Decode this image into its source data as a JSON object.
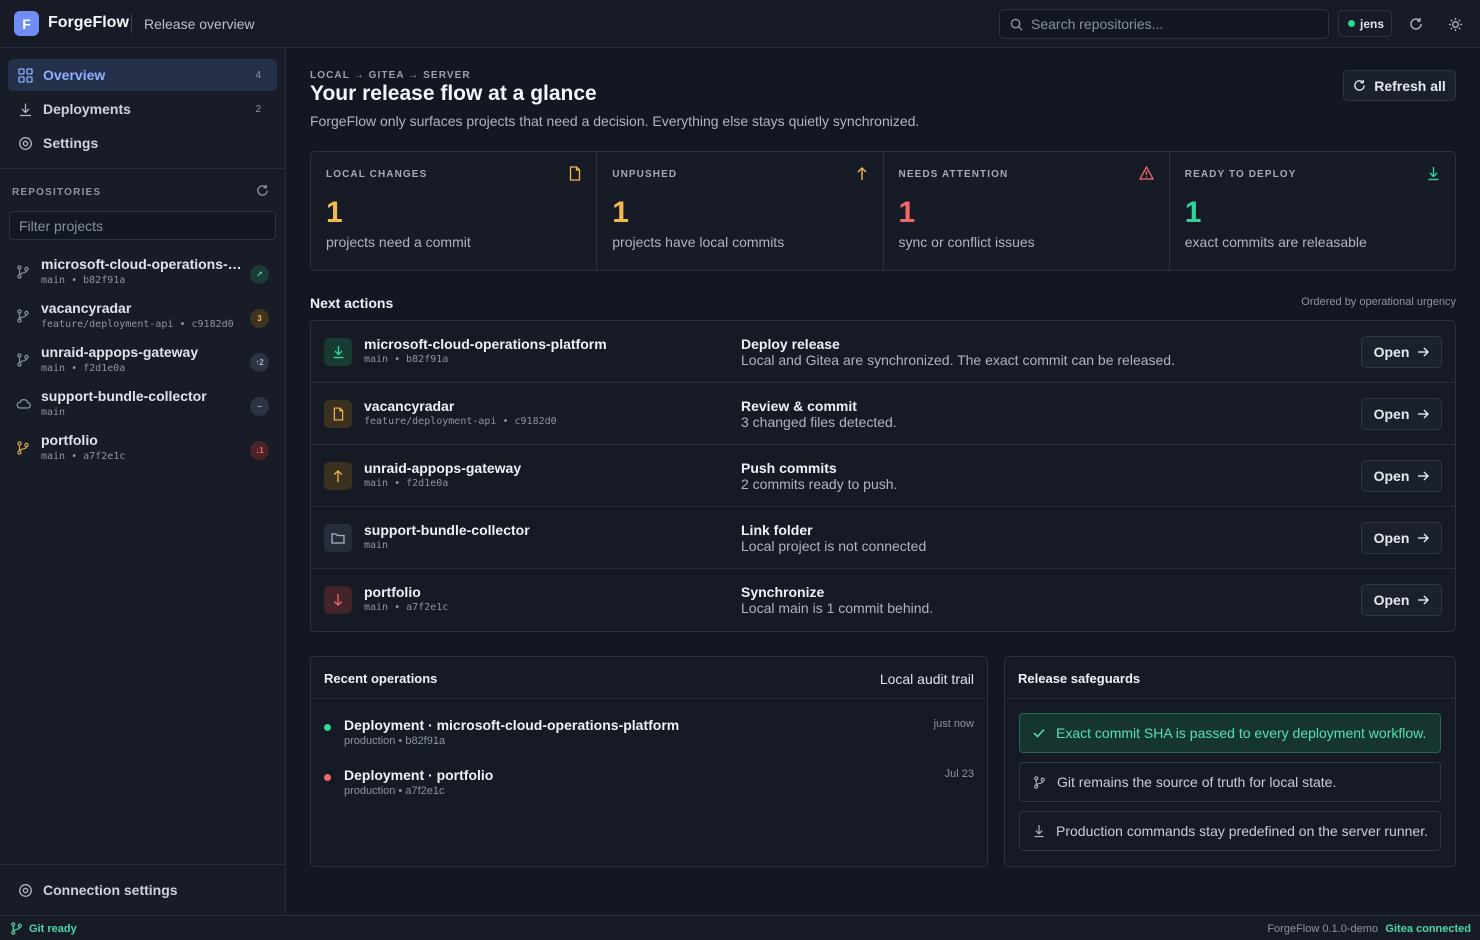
{
  "header": {
    "logo_letter": "F",
    "app_name": "ForgeFlow",
    "page": "Release overview",
    "search_placeholder": "Search repositories...",
    "user": "jens"
  },
  "sidebar": {
    "nav": [
      {
        "label": "Overview",
        "count": "4",
        "icon": "grid-icon",
        "active": true
      },
      {
        "label": "Deployments",
        "count": "2",
        "icon": "download-icon",
        "active": false
      },
      {
        "label": "Settings",
        "count": "",
        "icon": "gear-icon",
        "active": false
      }
    ],
    "section_title": "REPOSITORIES",
    "filter_placeholder": "Filter projects",
    "repos": [
      {
        "name": "microsoft-cloud-operations-platform",
        "branch": "main",
        "sha": "b82f91a",
        "meta": "main • b82f91a",
        "badge": "↗",
        "icon": "branch-icon"
      },
      {
        "name": "vacancyradar",
        "branch": "feature/deployment-api",
        "sha": "c9182d0",
        "meta": "feature/deployment-api • c9182d0",
        "badge": "3",
        "icon": "branch-icon"
      },
      {
        "name": "unraid-appops-gateway",
        "branch": "main",
        "sha": "f2d1e0a",
        "meta": "main • f2d1e0a",
        "badge": "↑2",
        "icon": "branch-icon"
      },
      {
        "name": "support-bundle-collector",
        "branch": "main",
        "sha": "",
        "meta": "main",
        "badge": "–",
        "icon": "cloud-icon"
      },
      {
        "name": "portfolio",
        "branch": "main",
        "sha": "a7f2e1c",
        "meta": "main • a7f2e1c",
        "badge": "↓1",
        "icon": "branch-icon"
      }
    ],
    "connection_settings": "Connection settings"
  },
  "main": {
    "breadcrumb": "LOCAL → GITEA → SERVER",
    "title": "Your release flow at a glance",
    "subtitle": "ForgeFlow only surfaces projects that need a decision. Everything else stays quietly synchronized.",
    "refresh_label": "Refresh all",
    "stats": [
      {
        "title": "LOCAL CHANGES",
        "value": "1",
        "label": "projects need a commit",
        "icon": "file-icon",
        "color": "#f5b84a"
      },
      {
        "title": "UNPUSHED",
        "value": "1",
        "label": "projects have local commits",
        "icon": "arrow-up-icon",
        "color": "#f5b84a"
      },
      {
        "title": "NEEDS ATTENTION",
        "value": "1",
        "label": "sync or conflict issues",
        "icon": "warning-icon",
        "color": "#f06a6a"
      },
      {
        "title": "READY TO DEPLOY",
        "value": "1",
        "label": "exact commits are releasable",
        "icon": "download-icon",
        "color": "#34d39b"
      }
    ],
    "next_actions_title": "Next actions",
    "next_actions_hint": "Ordered by operational urgency",
    "actions": [
      {
        "name": "microsoft-cloud-operations-platform",
        "meta": "main • b82f91a",
        "title": "Deploy release",
        "desc": "Local and Gitea are synchronized. The exact commit can be released.",
        "button": "Open",
        "icon": "download-icon"
      },
      {
        "name": "vacancyradar",
        "meta": "feature/deployment-api • c9182d0",
        "title": "Review & commit",
        "desc": "3 changed files detected.",
        "button": "Open",
        "icon": "file-icon"
      },
      {
        "name": "unraid-appops-gateway",
        "meta": "main • f2d1e0a",
        "title": "Push commits",
        "desc": "2 commits ready to push.",
        "button": "Open",
        "icon": "arrow-up-icon"
      },
      {
        "name": "support-bundle-collector",
        "meta": "main",
        "title": "Link folder",
        "desc": "Local project is not connected",
        "button": "Open",
        "icon": "folder-icon"
      },
      {
        "name": "portfolio",
        "meta": "main • a7f2e1c",
        "title": "Synchronize",
        "desc": "Local main is 1 commit behind.",
        "button": "Open",
        "icon": "arrow-down-icon"
      }
    ],
    "recent": {
      "title": "Recent operations",
      "aside": "Local audit trail",
      "items": [
        {
          "name": "Deployment · microsoft-cloud-operations-platform",
          "meta": "production • b82f91a",
          "time": "just now",
          "status_color": "#34d39b"
        },
        {
          "name": "Deployment · portfolio",
          "meta": "production • a7f2e1c",
          "time": "Jul 23",
          "status_color": "#f06a6a"
        }
      ]
    },
    "safeguards": {
      "title": "Release safeguards",
      "items": [
        {
          "text": "Exact commit SHA is passed to every deployment workflow.",
          "icon": "check-icon"
        },
        {
          "text": "Git remains the source of truth for local state.",
          "icon": "branch-icon"
        },
        {
          "text": "Production commands stay predefined on the server runner.",
          "icon": "download-icon"
        }
      ]
    }
  },
  "statusbar": {
    "git_status": "Git ready",
    "version": "ForgeFlow 0.1.0-demo",
    "gitea_status": "Gitea connected"
  },
  "colors": {
    "accent": "#6f8df5",
    "success": "#34d39b",
    "warning": "#f5b84a",
    "danger": "#f06a6a"
  }
}
